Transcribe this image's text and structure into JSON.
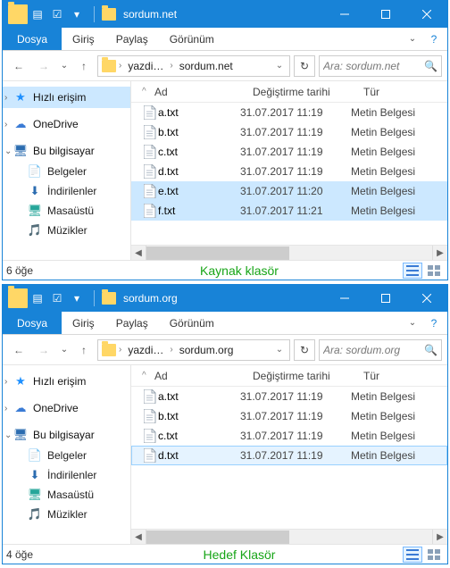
{
  "windows": [
    {
      "title": "sordum.net",
      "ribbon": {
        "file": "Dosya",
        "tabs": [
          "Giriş",
          "Paylaş",
          "Görünüm"
        ]
      },
      "breadcrumb": [
        "yazdi…",
        "sordum.net"
      ],
      "search_placeholder": "Ara: sordum.net",
      "columns": {
        "name": "Ad",
        "date": "Değiştirme tarihi",
        "type": "Tür"
      },
      "sidebar": {
        "quick": "Hızlı erişim",
        "onedrive": "OneDrive",
        "thispc": "Bu bilgisayar",
        "items": [
          "Belgeler",
          "İndirilenler",
          "Masaüstü",
          "Müzikler"
        ]
      },
      "files": [
        {
          "name": "a.txt",
          "date": "31.07.2017 11:19",
          "type": "Metin Belgesi",
          "sel": false
        },
        {
          "name": "b.txt",
          "date": "31.07.2017 11:19",
          "type": "Metin Belgesi",
          "sel": false
        },
        {
          "name": "c.txt",
          "date": "31.07.2017 11:19",
          "type": "Metin Belgesi",
          "sel": false
        },
        {
          "name": "d.txt",
          "date": "31.07.2017 11:19",
          "type": "Metin Belgesi",
          "sel": false
        },
        {
          "name": "e.txt",
          "date": "31.07.2017 11:20",
          "type": "Metin Belgesi",
          "sel": true
        },
        {
          "name": "f.txt",
          "date": "31.07.2017 11:21",
          "type": "Metin Belgesi",
          "sel": true
        }
      ],
      "status_count": "6 öğe",
      "status_label": "Kaynak klasör"
    },
    {
      "title": "sordum.org",
      "ribbon": {
        "file": "Dosya",
        "tabs": [
          "Giriş",
          "Paylaş",
          "Görünüm"
        ]
      },
      "breadcrumb": [
        "yazdi…",
        "sordum.org"
      ],
      "search_placeholder": "Ara: sordum.org",
      "columns": {
        "name": "Ad",
        "date": "Değiştirme tarihi",
        "type": "Tür"
      },
      "sidebar": {
        "quick": "Hızlı erişim",
        "onedrive": "OneDrive",
        "thispc": "Bu bilgisayar",
        "items": [
          "Belgeler",
          "İndirilenler",
          "Masaüstü",
          "Müzikler"
        ]
      },
      "files": [
        {
          "name": "a.txt",
          "date": "31.07.2017 11:19",
          "type": "Metin Belgesi",
          "sel": false
        },
        {
          "name": "b.txt",
          "date": "31.07.2017 11:19",
          "type": "Metin Belgesi",
          "sel": false
        },
        {
          "name": "c.txt",
          "date": "31.07.2017 11:19",
          "type": "Metin Belgesi",
          "sel": false
        },
        {
          "name": "d.txt",
          "date": "31.07.2017 11:19",
          "type": "Metin Belgesi",
          "sel": false,
          "focus": true
        }
      ],
      "status_count": "4 öğe",
      "status_label": "Hedef Klasör"
    }
  ]
}
